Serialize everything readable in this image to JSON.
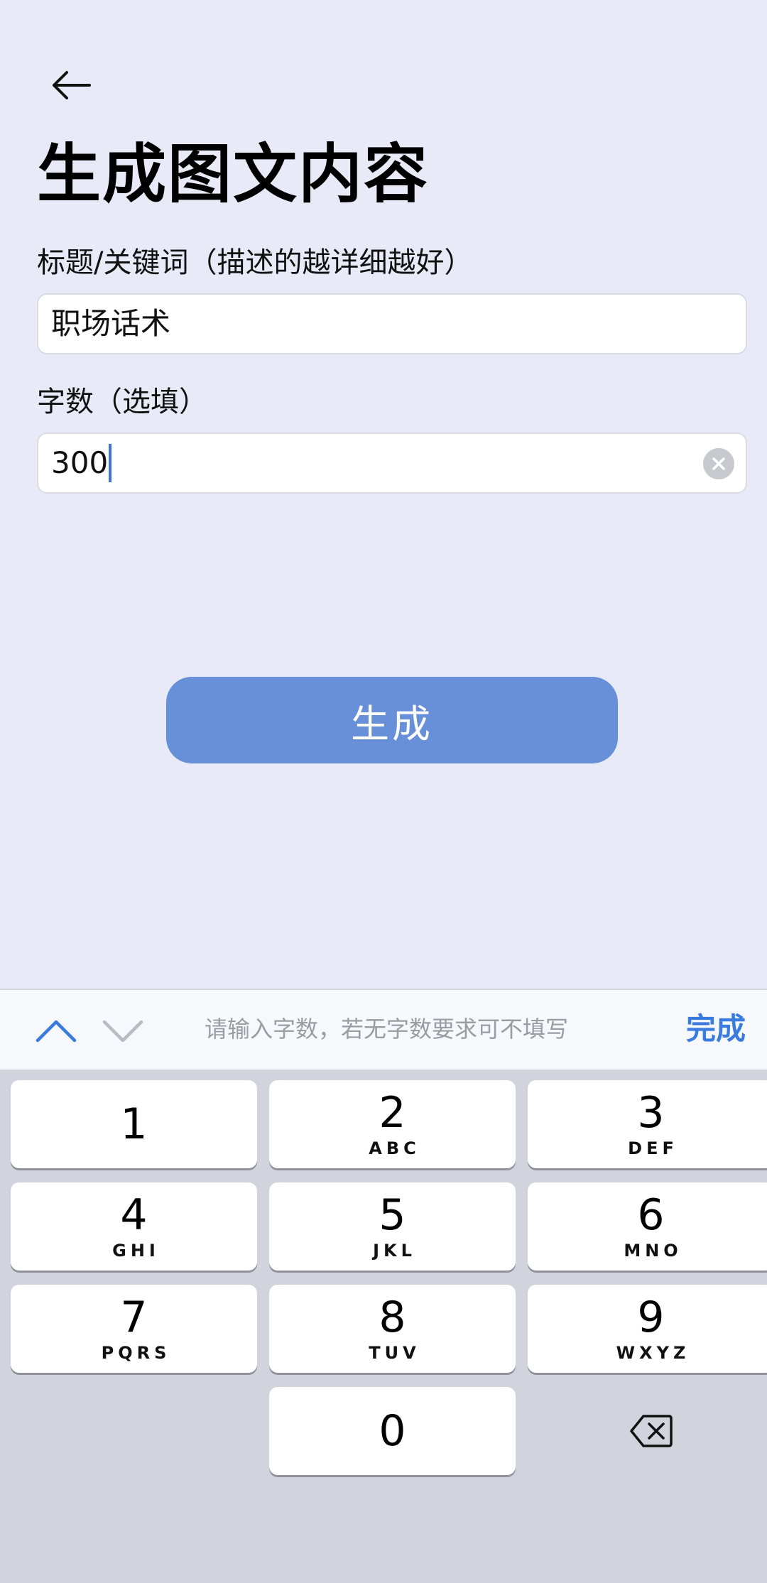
{
  "header": {
    "back_icon": "arrow-left-icon",
    "title": "生成图文内容"
  },
  "form": {
    "keyword_label": "标题/关键词（描述的越详细越好）",
    "keyword_value": "职场话术",
    "count_label": "字数（选填）",
    "count_value": "300",
    "clear_icon": "clear-circle-icon"
  },
  "generate_label": "生成",
  "keyboard_toolbar": {
    "up_icon": "chevron-up-icon",
    "down_icon": "chevron-down-icon",
    "hint": "请输入字数，若无字数要求可不填写",
    "done_label": "完成"
  },
  "keypad": {
    "keys": [
      {
        "digit": "1",
        "letters": ""
      },
      {
        "digit": "2",
        "letters": "ABC"
      },
      {
        "digit": "3",
        "letters": "DEF"
      },
      {
        "digit": "4",
        "letters": "GHI"
      },
      {
        "digit": "5",
        "letters": "JKL"
      },
      {
        "digit": "6",
        "letters": "MNO"
      },
      {
        "digit": "7",
        "letters": "PQRS"
      },
      {
        "digit": "8",
        "letters": "TUV"
      },
      {
        "digit": "9",
        "letters": "WXYZ"
      },
      {
        "digit": "0",
        "letters": ""
      }
    ],
    "delete_icon": "backspace-icon"
  },
  "colors": {
    "background": "#e8ebf7",
    "primary_button": "#6790d9",
    "accent": "#3a7be0",
    "caret": "#3f73d9",
    "keyboard_bg": "#d1d4dc"
  }
}
